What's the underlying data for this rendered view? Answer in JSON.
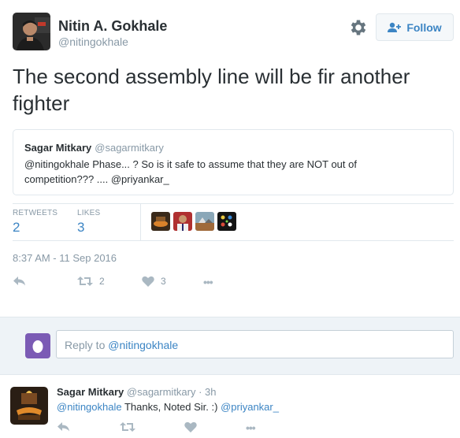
{
  "tweet": {
    "author_name": "Nitin A. Gokhale",
    "author_handle": "@nitingokhale",
    "follow_label": "Follow",
    "text": "The second assembly line will be fir another fighter",
    "quote": {
      "author_name": "Sagar Mitkary",
      "author_handle": "@sagarmitkary",
      "text_mention": "@nitingokhale",
      "text_body": " Phase... ? So is it safe to assume  that they are NOT out of competition??? .... ",
      "text_mention2": "@priyankar_"
    },
    "stats": {
      "retweets_label": "RETWEETS",
      "retweets_value": "2",
      "likes_label": "LIKES",
      "likes_value": "3"
    },
    "timestamp": "8:37 AM - 11 Sep 2016",
    "actions": {
      "retweet_count": "2",
      "like_count": "3",
      "more_label": "•••"
    }
  },
  "reply_box": {
    "prefix": "Reply to ",
    "mention": "@nitingokhale"
  },
  "reply": {
    "author_name": "Sagar Mitkary",
    "author_handle": "@sagarmitkary",
    "time": " · 3h",
    "mention": "@nitingokhale",
    "text": " Thanks, Noted Sir. :) ",
    "mention2": "@priyankar_",
    "more_label": "•••"
  },
  "colors": {
    "link": "#3c85c4",
    "muted": "#8899a6",
    "text": "#292f33",
    "egg_avatar": "#7b5bb5"
  }
}
